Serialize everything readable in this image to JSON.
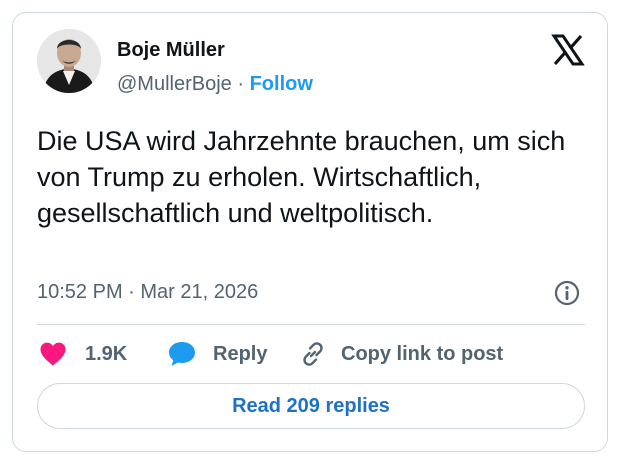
{
  "author": {
    "name": "Boje Müller",
    "handle": "@MullerBoje",
    "separator": " · ",
    "follow_label": "Follow"
  },
  "tweet": {
    "text": "Die USA wird Jahrzehnte brauchen, um sich von Trump zu erholen. Wirtschaftlich, gesellschaftlich und weltpolitisch.",
    "timestamp": "10:52 PM · Mar 21, 2026"
  },
  "actions": {
    "likes_count": "1.9K",
    "reply_label": "Reply",
    "copy_link_label": "Copy link to post"
  },
  "read_replies_label": "Read 209 replies",
  "icons": {
    "brand": "x-logo-icon",
    "info": "info-icon",
    "like": "heart-icon",
    "reply": "speech-bubble-icon",
    "copy": "link-icon"
  },
  "colors": {
    "accent": "#1d9bf0",
    "heart": "#f91880",
    "muted": "#536471",
    "border": "#cfd9de"
  }
}
